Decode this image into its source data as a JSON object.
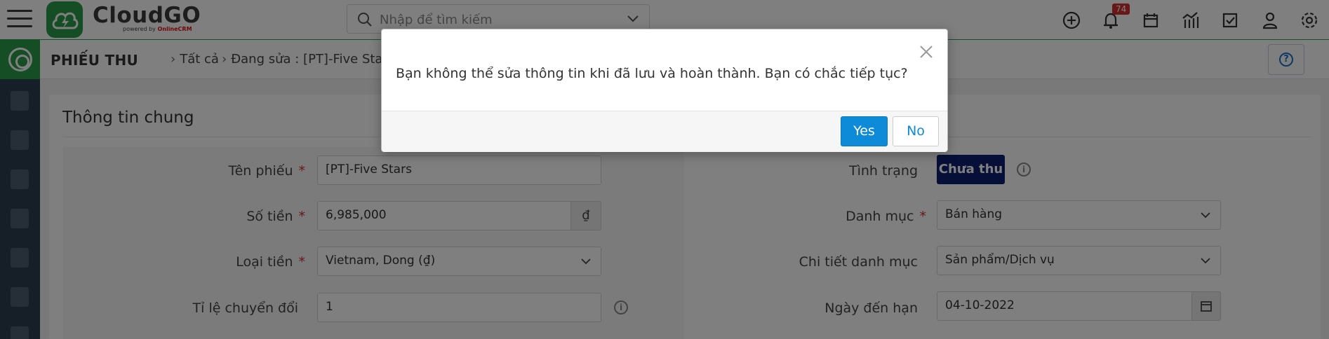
{
  "app": {
    "name": "CloudGO",
    "powered_by": "powered by",
    "powered_brand": "OnlineCRM"
  },
  "topbar": {
    "search_placeholder": "Nhập để tìm kiếm",
    "notification_count": "74",
    "icons": [
      "add-circle-icon",
      "bell-icon",
      "calendar-icon",
      "chart-icon",
      "checkbox-icon",
      "user-icon",
      "gear-icon"
    ]
  },
  "breadcrumb": {
    "module": "PHIẾU THU",
    "level1": "Tất cả",
    "level2": "Đang sửa : [PT]-Five Stars"
  },
  "card": {
    "title": "Thông tin chung"
  },
  "form": {
    "left": [
      {
        "label": "Tên phiếu",
        "required": true,
        "value": "[PT]-Five Stars"
      },
      {
        "label": "Số tiền",
        "required": true,
        "value": "6,985,000",
        "addon": "₫"
      },
      {
        "label": "Loại tiền",
        "required": true,
        "value": "Vietnam, Dong (₫)"
      },
      {
        "label": "Tỉ lệ chuyển đổi",
        "required": false,
        "value": "1"
      }
    ],
    "right": [
      {
        "label": "Tình trạng",
        "value": "Chưa thu"
      },
      {
        "label": "Danh mục",
        "required": true,
        "value": "Bán hàng"
      },
      {
        "label": "Chi tiết danh mục",
        "value": "Sản phẩm/Dịch vụ"
      },
      {
        "label": "Ngày đến hạn",
        "value": "04-10-2022"
      }
    ]
  },
  "modal": {
    "message": "Bạn không thể sửa thông tin khi đã lưu và hoàn thành. Bạn có chắc tiếp tục?",
    "yes_label": "Yes",
    "no_label": "No"
  },
  "colors": {
    "brand_green": "#2a9c48",
    "sidebar": "#2c3e50",
    "primary_blue": "#0d8ad8",
    "status_navy": "#0d1f6e"
  }
}
